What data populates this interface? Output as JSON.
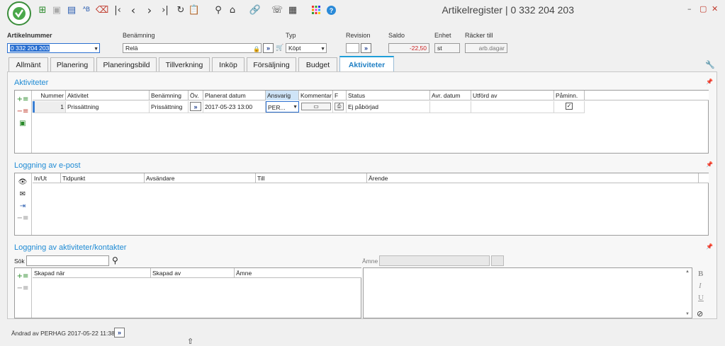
{
  "window": {
    "title": "Artikelregister | 0 332 204 203"
  },
  "toolbar": {
    "icons": [
      "app-logo",
      "add",
      "save-disabled",
      "save-as",
      "spellcheck",
      "delete",
      "first",
      "previous",
      "next",
      "last",
      "refresh",
      "paste",
      "search",
      "home",
      "link",
      "phone",
      "report",
      "grid-menu",
      "help"
    ]
  },
  "header": {
    "artikelnummer_label": "Artikelnummer",
    "artikelnummer_value": "0 332 204 203",
    "benamning_label": "Benämning",
    "benamning_value": "Relä",
    "typ_label": "Typ",
    "typ_value": "Köpt",
    "revision_label": "Revision",
    "revision_value": "",
    "saldo_label": "Saldo",
    "saldo_value": "-22,50",
    "enhet_label": "Enhet",
    "enhet_value": "st",
    "racker_label": "Räcker till",
    "racker_value": "arb.dagar"
  },
  "tabs": [
    {
      "label": "Allmänt"
    },
    {
      "label": "Planering"
    },
    {
      "label": "Planeringsbild"
    },
    {
      "label": "Tillverkning"
    },
    {
      "label": "Inköp"
    },
    {
      "label": "Försäljning"
    },
    {
      "label": "Budget"
    },
    {
      "label": "Aktiviteter",
      "active": true
    }
  ],
  "aktiviteter": {
    "title": "Aktiviteter",
    "columns": [
      "Nummer",
      "Aktivitet",
      "Benämning",
      "Öv.",
      "Planerat datum",
      "Ansvarig",
      "Kommentar",
      "F",
      "Status",
      "Avr. datum",
      "Utförd av",
      "Påminn."
    ],
    "rows": [
      {
        "nummer": "1",
        "aktivitet": "Prissättning",
        "benamning": "Prissättning",
        "planerat": "2017-05-23 13:00",
        "ansvarig": "PER...",
        "status": "Ej påbörjad",
        "avr": "",
        "utford": "",
        "paminn": true
      }
    ]
  },
  "epost": {
    "title": "Loggning av e-post",
    "columns": [
      "In/Ut",
      "Tidpunkt",
      "Avsändare",
      "Till",
      "Ärende"
    ]
  },
  "kontakter": {
    "title": "Loggning av aktiviteter/kontakter",
    "search_label": "Sök",
    "search_value": "",
    "amne_label": "Ämne",
    "amne_value": "",
    "columns": [
      "Skapad när",
      "Skapad av",
      "Ämne"
    ],
    "format_buttons": [
      "B",
      "I",
      "U"
    ]
  },
  "footer": {
    "changed_text": "Ändrad av PERHAG 2017-05-22 11:38"
  },
  "colors": {
    "accent": "#1f8bd4",
    "saldo": "#cc2222",
    "logo": "#3a8d3a"
  }
}
